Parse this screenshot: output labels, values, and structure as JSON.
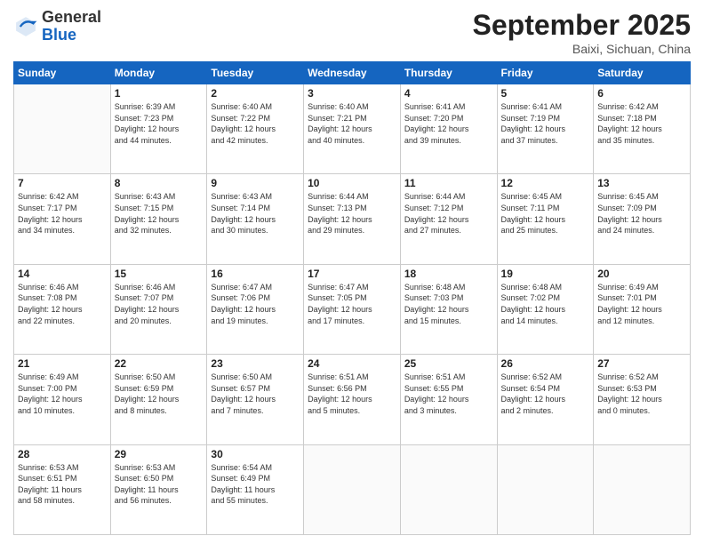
{
  "header": {
    "logo_general": "General",
    "logo_blue": "Blue",
    "month": "September 2025",
    "location": "Baixi, Sichuan, China"
  },
  "days_of_week": [
    "Sunday",
    "Monday",
    "Tuesday",
    "Wednesday",
    "Thursday",
    "Friday",
    "Saturday"
  ],
  "weeks": [
    [
      {
        "day": "",
        "text": ""
      },
      {
        "day": "1",
        "text": "Sunrise: 6:39 AM\nSunset: 7:23 PM\nDaylight: 12 hours\nand 44 minutes."
      },
      {
        "day": "2",
        "text": "Sunrise: 6:40 AM\nSunset: 7:22 PM\nDaylight: 12 hours\nand 42 minutes."
      },
      {
        "day": "3",
        "text": "Sunrise: 6:40 AM\nSunset: 7:21 PM\nDaylight: 12 hours\nand 40 minutes."
      },
      {
        "day": "4",
        "text": "Sunrise: 6:41 AM\nSunset: 7:20 PM\nDaylight: 12 hours\nand 39 minutes."
      },
      {
        "day": "5",
        "text": "Sunrise: 6:41 AM\nSunset: 7:19 PM\nDaylight: 12 hours\nand 37 minutes."
      },
      {
        "day": "6",
        "text": "Sunrise: 6:42 AM\nSunset: 7:18 PM\nDaylight: 12 hours\nand 35 minutes."
      }
    ],
    [
      {
        "day": "7",
        "text": "Sunrise: 6:42 AM\nSunset: 7:17 PM\nDaylight: 12 hours\nand 34 minutes."
      },
      {
        "day": "8",
        "text": "Sunrise: 6:43 AM\nSunset: 7:15 PM\nDaylight: 12 hours\nand 32 minutes."
      },
      {
        "day": "9",
        "text": "Sunrise: 6:43 AM\nSunset: 7:14 PM\nDaylight: 12 hours\nand 30 minutes."
      },
      {
        "day": "10",
        "text": "Sunrise: 6:44 AM\nSunset: 7:13 PM\nDaylight: 12 hours\nand 29 minutes."
      },
      {
        "day": "11",
        "text": "Sunrise: 6:44 AM\nSunset: 7:12 PM\nDaylight: 12 hours\nand 27 minutes."
      },
      {
        "day": "12",
        "text": "Sunrise: 6:45 AM\nSunset: 7:11 PM\nDaylight: 12 hours\nand 25 minutes."
      },
      {
        "day": "13",
        "text": "Sunrise: 6:45 AM\nSunset: 7:09 PM\nDaylight: 12 hours\nand 24 minutes."
      }
    ],
    [
      {
        "day": "14",
        "text": "Sunrise: 6:46 AM\nSunset: 7:08 PM\nDaylight: 12 hours\nand 22 minutes."
      },
      {
        "day": "15",
        "text": "Sunrise: 6:46 AM\nSunset: 7:07 PM\nDaylight: 12 hours\nand 20 minutes."
      },
      {
        "day": "16",
        "text": "Sunrise: 6:47 AM\nSunset: 7:06 PM\nDaylight: 12 hours\nand 19 minutes."
      },
      {
        "day": "17",
        "text": "Sunrise: 6:47 AM\nSunset: 7:05 PM\nDaylight: 12 hours\nand 17 minutes."
      },
      {
        "day": "18",
        "text": "Sunrise: 6:48 AM\nSunset: 7:03 PM\nDaylight: 12 hours\nand 15 minutes."
      },
      {
        "day": "19",
        "text": "Sunrise: 6:48 AM\nSunset: 7:02 PM\nDaylight: 12 hours\nand 14 minutes."
      },
      {
        "day": "20",
        "text": "Sunrise: 6:49 AM\nSunset: 7:01 PM\nDaylight: 12 hours\nand 12 minutes."
      }
    ],
    [
      {
        "day": "21",
        "text": "Sunrise: 6:49 AM\nSunset: 7:00 PM\nDaylight: 12 hours\nand 10 minutes."
      },
      {
        "day": "22",
        "text": "Sunrise: 6:50 AM\nSunset: 6:59 PM\nDaylight: 12 hours\nand 8 minutes."
      },
      {
        "day": "23",
        "text": "Sunrise: 6:50 AM\nSunset: 6:57 PM\nDaylight: 12 hours\nand 7 minutes."
      },
      {
        "day": "24",
        "text": "Sunrise: 6:51 AM\nSunset: 6:56 PM\nDaylight: 12 hours\nand 5 minutes."
      },
      {
        "day": "25",
        "text": "Sunrise: 6:51 AM\nSunset: 6:55 PM\nDaylight: 12 hours\nand 3 minutes."
      },
      {
        "day": "26",
        "text": "Sunrise: 6:52 AM\nSunset: 6:54 PM\nDaylight: 12 hours\nand 2 minutes."
      },
      {
        "day": "27",
        "text": "Sunrise: 6:52 AM\nSunset: 6:53 PM\nDaylight: 12 hours\nand 0 minutes."
      }
    ],
    [
      {
        "day": "28",
        "text": "Sunrise: 6:53 AM\nSunset: 6:51 PM\nDaylight: 11 hours\nand 58 minutes."
      },
      {
        "day": "29",
        "text": "Sunrise: 6:53 AM\nSunset: 6:50 PM\nDaylight: 11 hours\nand 56 minutes."
      },
      {
        "day": "30",
        "text": "Sunrise: 6:54 AM\nSunset: 6:49 PM\nDaylight: 11 hours\nand 55 minutes."
      },
      {
        "day": "",
        "text": ""
      },
      {
        "day": "",
        "text": ""
      },
      {
        "day": "",
        "text": ""
      },
      {
        "day": "",
        "text": ""
      }
    ]
  ]
}
